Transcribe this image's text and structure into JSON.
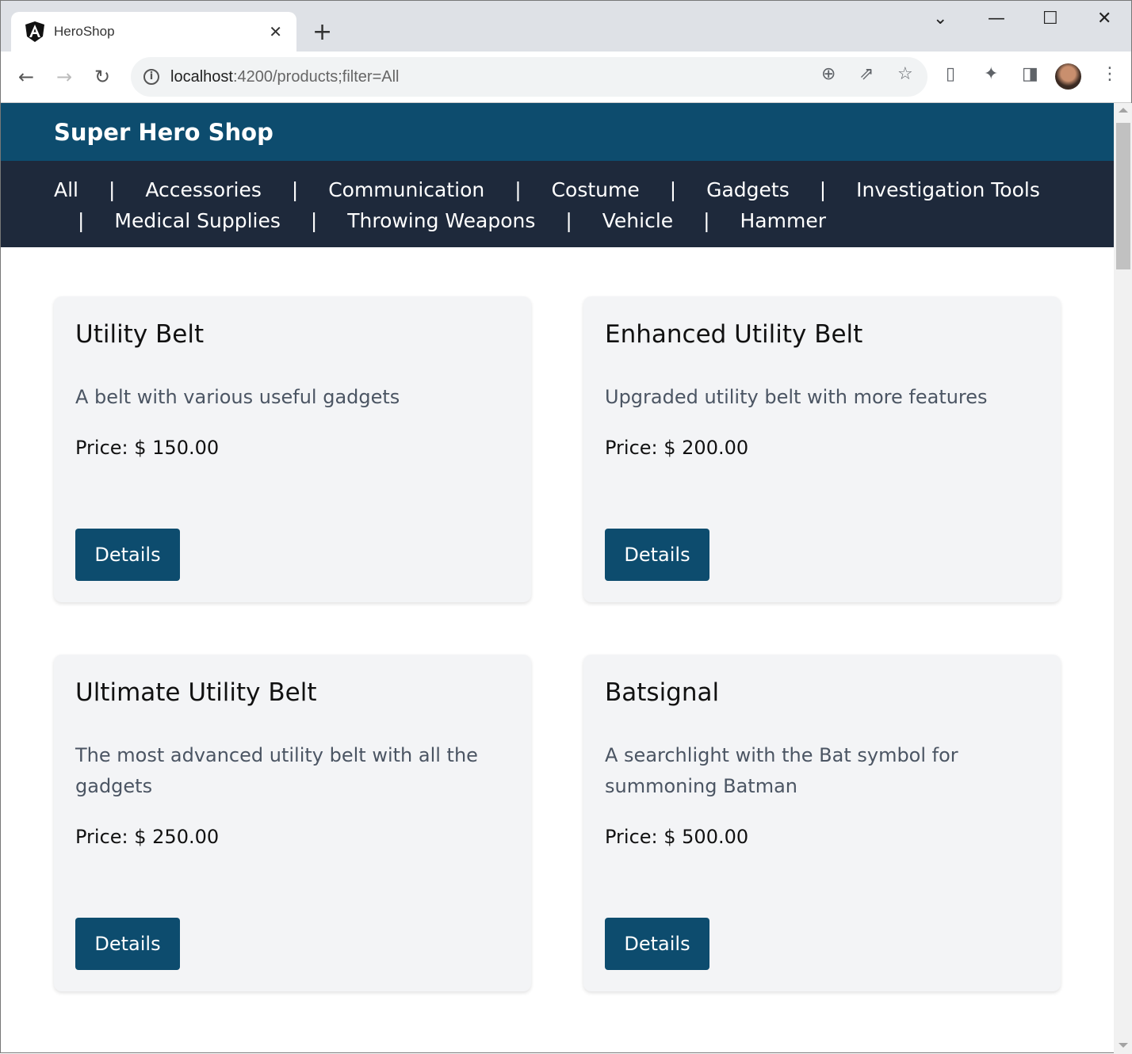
{
  "browser": {
    "tab_title": "HeroShop",
    "url_host": "localhost",
    "url_path": ":4200/products;filter=All"
  },
  "header": {
    "title": "Super Hero Shop"
  },
  "nav": {
    "items": [
      "All",
      "Accessories",
      "Communication",
      "Costume",
      "Gadgets",
      "Investigation Tools",
      "Medical Supplies",
      "Throwing Weapons",
      "Vehicle",
      "Hammer"
    ],
    "separator": "|"
  },
  "products": [
    {
      "name": "Utility Belt",
      "description": "A belt with various useful gadgets",
      "price": "Price: $ 150.00",
      "button": "Details"
    },
    {
      "name": "Enhanced Utility Belt",
      "description": "Upgraded utility belt with more features",
      "price": "Price: $ 200.00",
      "button": "Details"
    },
    {
      "name": "Ultimate Utility Belt",
      "description": "The most advanced utility belt with all the gadgets",
      "price": "Price: $ 250.00",
      "button": "Details"
    },
    {
      "name": "Batsignal",
      "description": "A searchlight with the Bat symbol for summoning Batman",
      "price": "Price: $ 500.00",
      "button": "Details"
    }
  ],
  "colors": {
    "header": "#0d4c6e",
    "nav": "#1e293b",
    "card": "#f3f4f6",
    "button": "#0d4c6e"
  }
}
